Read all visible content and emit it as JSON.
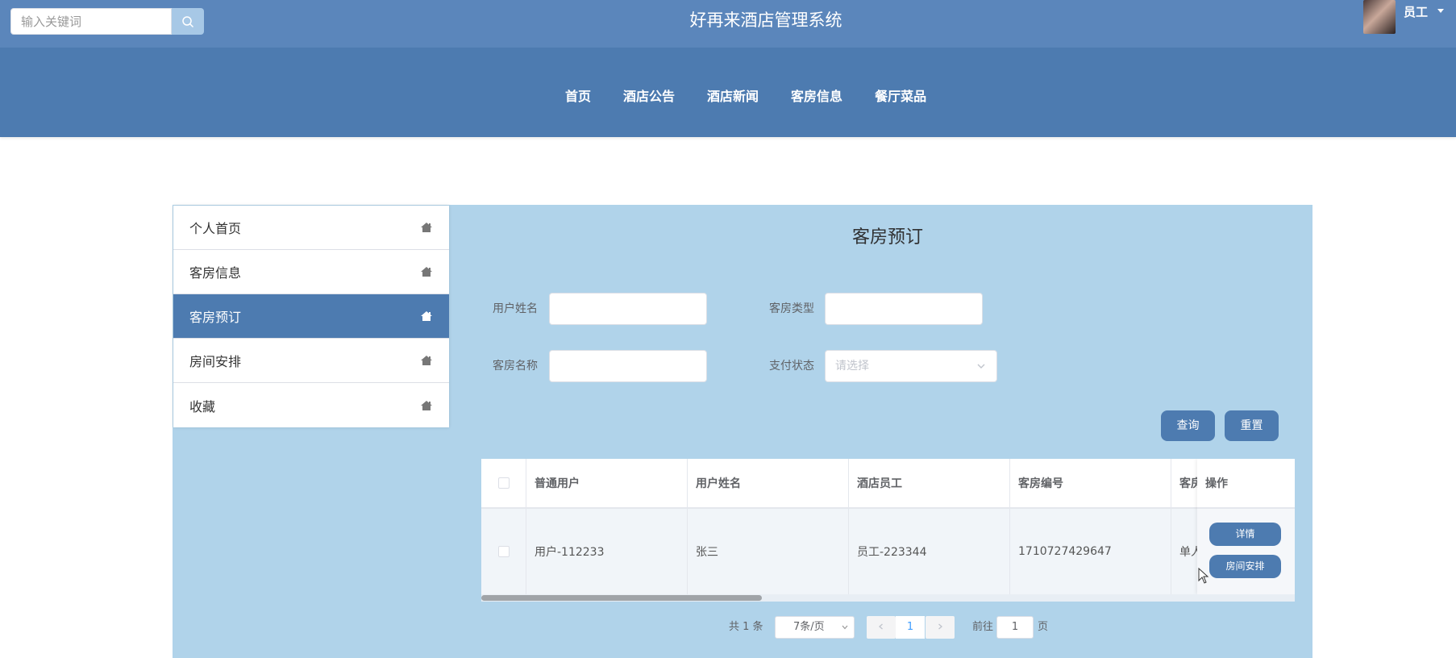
{
  "header": {
    "search_placeholder": "输入关键词",
    "site_title": "好再来酒店管理系统",
    "user_name": "员工"
  },
  "nav": {
    "items": [
      {
        "label": "首页"
      },
      {
        "label": "酒店公告"
      },
      {
        "label": "酒店新闻"
      },
      {
        "label": "客房信息"
      },
      {
        "label": "餐厅菜品"
      }
    ]
  },
  "sidebar": {
    "items": [
      {
        "label": "个人首页",
        "active": false
      },
      {
        "label": "客房信息",
        "active": false
      },
      {
        "label": "客房预订",
        "active": true
      },
      {
        "label": "房间安排",
        "active": false
      },
      {
        "label": "收藏",
        "active": false
      }
    ]
  },
  "main": {
    "title": "客房预订",
    "filters": {
      "user_name_label": "用户姓名",
      "room_type_label": "客房类型",
      "room_name_label": "客房名称",
      "pay_status_label": "支付状态",
      "pay_status_placeholder": "请选择"
    },
    "query_button": "查询",
    "reset_button": "重置",
    "table": {
      "columns": [
        "普通用户",
        "用户姓名",
        "酒店员工",
        "客房编号",
        "客房"
      ],
      "op_column": "操作",
      "rows": [
        {
          "cells": [
            "用户-112233",
            "张三",
            "员工-223344",
            "1710727429647",
            "单人"
          ]
        }
      ],
      "detail_button": "详情",
      "arrange_button": "房间安排"
    },
    "pagination": {
      "total": "共 1 条",
      "page_size": "7条/页",
      "current_page": "1",
      "goto_label": "前往",
      "goto_value": "1",
      "page_suffix": "页"
    }
  },
  "colors": {
    "topbar": "#5b86bb",
    "nav": "#4d7bb0",
    "panel": "#b0d3ea",
    "accent": "#4d7bb0"
  }
}
